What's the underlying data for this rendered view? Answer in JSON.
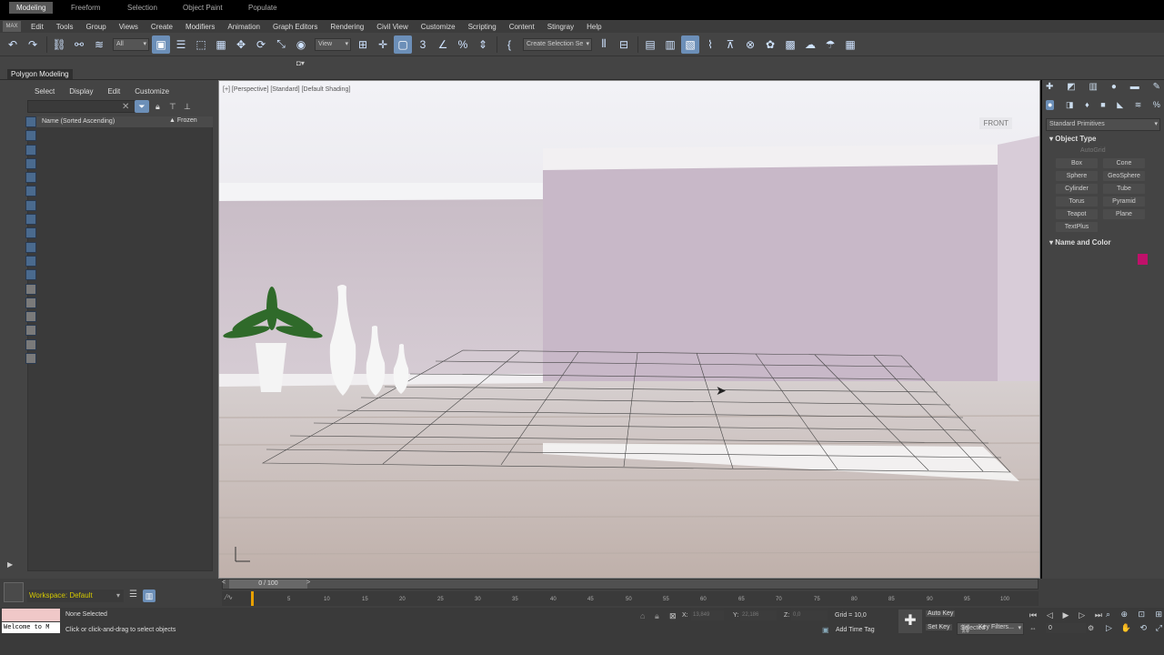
{
  "menubar": {
    "logo": "MAX",
    "items": [
      "Edit",
      "Tools",
      "Group",
      "Views",
      "Create",
      "Modifiers",
      "Animation",
      "Graph Editors",
      "Rendering",
      "Civil View",
      "Customize",
      "Scripting",
      "Content",
      "Stingray",
      "Help"
    ]
  },
  "toolbar": {
    "selection_filter": "All",
    "ref_coord": "View",
    "named_selection": "Create Selection Se"
  },
  "ribbon": {
    "tabs": [
      "Modeling",
      "Freeform",
      "Selection",
      "Object Paint",
      "Populate"
    ],
    "active_tab": "Modeling",
    "subpanel": "Polygon Modeling"
  },
  "scene_explorer": {
    "tabs": [
      "Select",
      "Display",
      "Edit",
      "Customize"
    ],
    "column_name": "Name (Sorted Ascending)",
    "column_frozen": "▲ Frozen"
  },
  "viewport": {
    "label": "[+] [Perspective] [Standard] [Default Shading]",
    "viewcube_label": "FRONT"
  },
  "command_panel": {
    "dropdown": "Standard Primitives",
    "object_type_title": "Object Type",
    "autogrid": "AutoGrid",
    "buttons": [
      "Box",
      "Cone",
      "Sphere",
      "GeoSphere",
      "Cylinder",
      "Tube",
      "Torus",
      "Pyramid",
      "Teapot",
      "Plane",
      "TextPlus"
    ],
    "name_color_title": "Name and Color",
    "object_color": "#c0106a"
  },
  "timeline": {
    "slider_label": "0 / 100",
    "ticks": [
      "5",
      "10",
      "15",
      "20",
      "25",
      "30",
      "35",
      "40",
      "45",
      "50",
      "55",
      "60",
      "65",
      "70",
      "75",
      "80",
      "85",
      "90",
      "95",
      "100"
    ]
  },
  "status": {
    "workspace": "Workspace: Default",
    "maxscript": "Welcome to M",
    "selection": "None Selected",
    "prompt": "Click or click-and-drag to select objects",
    "x_label": "X:",
    "x_value": "13,849",
    "y_label": "Y:",
    "y_value": "22,186",
    "z_label": "Z:",
    "z_value": "0,0",
    "grid": "Grid = 10,0",
    "add_time_tag": "Add Time Tag",
    "auto_key": "Auto Key",
    "set_key": "Set Key",
    "key_dropdown": "Selected",
    "key_filters": "Key Filters...",
    "frame": "0"
  }
}
